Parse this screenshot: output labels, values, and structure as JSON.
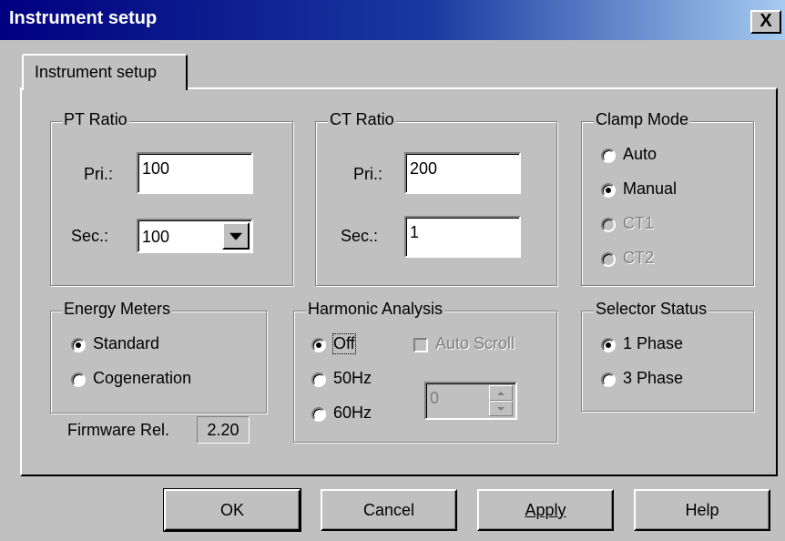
{
  "window": {
    "title": "Instrument setup",
    "close_glyph": "X"
  },
  "tab": {
    "label": "Instrument setup"
  },
  "pt_ratio": {
    "title": "PT Ratio",
    "pri_label": "Pri.:",
    "pri_value": "100",
    "sec_label": "Sec.:",
    "sec_value": "100"
  },
  "ct_ratio": {
    "title": "CT Ratio",
    "pri_label": "Pri.:",
    "pri_value": "200",
    "sec_label": "Sec.:",
    "sec_value": "1"
  },
  "clamp_mode": {
    "title": "Clamp Mode",
    "options": [
      {
        "label": "Auto",
        "selected": false,
        "enabled": true
      },
      {
        "label": "Manual",
        "selected": true,
        "enabled": true
      },
      {
        "label": "CT1",
        "selected": false,
        "enabled": false
      },
      {
        "label": "CT2",
        "selected": false,
        "enabled": false
      }
    ]
  },
  "energy_meters": {
    "title": "Energy Meters",
    "options": [
      {
        "label": "Standard",
        "selected": true
      },
      {
        "label": "Cogeneration",
        "selected": false
      }
    ]
  },
  "harmonic_analysis": {
    "title": "Harmonic Analysis",
    "options": [
      {
        "label": "Off",
        "selected": true
      },
      {
        "label": "50Hz",
        "selected": false
      },
      {
        "label": "60Hz",
        "selected": false
      }
    ],
    "auto_scroll_label": "Auto Scroll",
    "auto_scroll_enabled": false,
    "spin_value": "0"
  },
  "selector_status": {
    "title": "Selector Status",
    "options": [
      {
        "label": "1 Phase",
        "selected": true
      },
      {
        "label": "3 Phase",
        "selected": false
      }
    ]
  },
  "firmware": {
    "label": "Firmware Rel.",
    "value": "2.20"
  },
  "buttons": {
    "ok": "OK",
    "cancel": "Cancel",
    "apply": "Apply",
    "help": "Help"
  },
  "colors": {
    "face": "#c0c0c0",
    "title_start": "#000080",
    "title_end": "#a6caf0",
    "disabled_text": "#808080"
  }
}
